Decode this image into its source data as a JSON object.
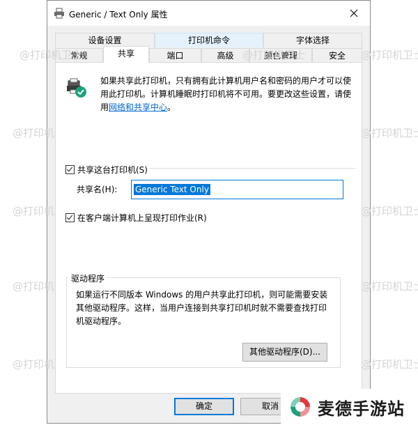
{
  "window": {
    "title": "Generic / Text Only 属性"
  },
  "tabs_row1": [
    "设备设置",
    "打印机命令",
    "字体选择"
  ],
  "tabs_row2": [
    "常规",
    "共享",
    "端口",
    "高级",
    "颜色管理",
    "安全"
  ],
  "info": {
    "text": "如果共享此打印机，只有拥有此计算机用户名和密码的用户才可以使用此打印机。计算机睡眠时打印机将不可用。要更改这些设置，请使用",
    "link": "网络和共享中心",
    "suffix": "。"
  },
  "share_checkbox": {
    "label": "共享这台打印机(S)",
    "checked": true
  },
  "share_name": {
    "label": "共享名(H):",
    "value": "Generic  Text Only"
  },
  "render_checkbox": {
    "label": "在客户端计算机上呈现打印作业(R)",
    "checked": true
  },
  "drivers": {
    "title": "驱动程序",
    "text": "如果运行不同版本 Windows 的用户共享此打印机，则可能需要安装其他驱动程序。这样，当用户连接到共享打印机时就不需要查找打印机驱动程序。",
    "button": "其他驱动程序(D)..."
  },
  "buttons": {
    "ok": "确定",
    "cancel": "取消"
  },
  "watermark_text": "@打印机卫士",
  "brand_badge": {
    "text": "麦德手游站"
  },
  "colors": {
    "accent": "#0078d7",
    "link": "#0066cc",
    "logo_red": "#e03a3e",
    "logo_green": "#1aa37a"
  },
  "icons": [
    "printer-icon",
    "close-icon",
    "shared-printer-icon",
    "check-icon",
    "brand-logo-icon"
  ]
}
